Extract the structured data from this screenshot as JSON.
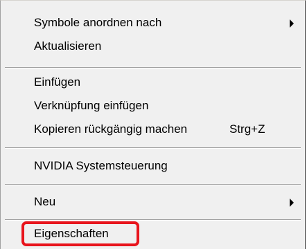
{
  "context_menu": {
    "items": [
      {
        "label": "Symbole anordnen nach",
        "shortcut": "",
        "submenu": true
      },
      {
        "label": "Aktualisieren",
        "shortcut": "",
        "submenu": false
      },
      {
        "label": "Einfügen",
        "shortcut": "",
        "submenu": false
      },
      {
        "label": "Verknüpfung einfügen",
        "shortcut": "",
        "submenu": false
      },
      {
        "label": "Kopieren rückgängig machen",
        "shortcut": "Strg+Z",
        "submenu": false
      },
      {
        "label": "NVIDIA Systemsteuerung",
        "shortcut": "",
        "submenu": false
      },
      {
        "label": "Neu",
        "shortcut": "",
        "submenu": true
      },
      {
        "label": "Eigenschaften",
        "shortcut": "",
        "submenu": false
      }
    ],
    "highlighted_item": "Eigenschaften",
    "highlight_color": "#e8141c"
  }
}
